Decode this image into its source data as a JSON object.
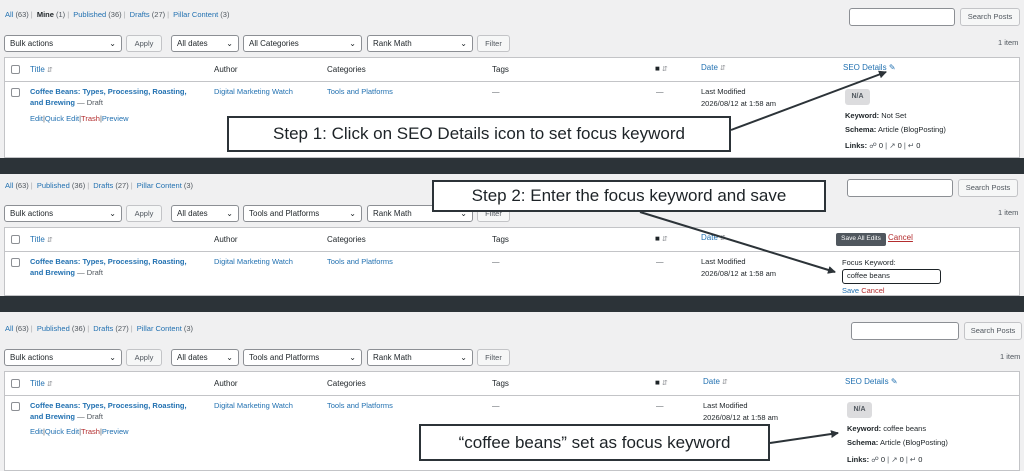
{
  "views": {
    "all": "All",
    "all_count": "(63)",
    "mine": "Mine",
    "mine_count": "(1)",
    "published": "Published",
    "published_count": "(36)",
    "drafts": "Drafts",
    "drafts_count": "(27)",
    "pillar": "Pillar Content",
    "pillar_count": "(3)",
    "sep": "|"
  },
  "toolbar": {
    "bulk_actions": "Bulk actions",
    "apply": "Apply",
    "all_dates": "All dates",
    "all_categories": "All Categories",
    "tools_platforms": "Tools and Platforms",
    "rank_math": "Rank Math",
    "filter": "Filter",
    "search_posts": "Search Posts",
    "items": "1 item"
  },
  "columns": {
    "title": "Title",
    "author": "Author",
    "categories": "Categories",
    "tags": "Tags",
    "date": "Date",
    "seo_details": "SEO Details"
  },
  "post": {
    "title_line1": "Coffee Beans: Types, Processing, Roasting,",
    "title_line2": "and Brewing",
    "state": "— Draft",
    "action_edit": "Edit",
    "action_quick_edit": "Quick Edit",
    "action_trash": "Trash",
    "action_preview": "Preview",
    "author": "Digital Marketing Watch",
    "category": "Tools and Platforms",
    "tags": "—",
    "comments": "—",
    "date_status": "Last Modified",
    "date_value": "2026/08/12 at 1:58 am"
  },
  "seo": {
    "na": "N/A",
    "keyword_label": "Keyword:",
    "keyword_not_set": "Not Set",
    "keyword_set": "coffee beans",
    "schema_label": "Schema:",
    "schema_value": "Article (BlogPosting)",
    "links_label": "Links:",
    "links_internal": "0",
    "links_external": "0",
    "links_incoming": "0",
    "save_all_edits": "Save All Edits",
    "cancel": "Cancel",
    "focus_keyword_label": "Focus Keyword:",
    "focus_keyword_value": "coffee beans",
    "save": "Save"
  },
  "callouts": {
    "step1": "Step 1: Click on SEO Details icon to set focus keyword",
    "step2": "Step 2: Enter the focus keyword and save",
    "step3": "“coffee beans” set as focus keyword"
  },
  "colors": {
    "link": "#2271b1",
    "trash": "#b32d2e",
    "divider": "#2c3338"
  },
  "icons": [
    "sort-icon",
    "comment-icon",
    "pencil-icon",
    "link-icon",
    "external-link-icon",
    "incoming-link-icon",
    "checkbox-icon",
    "chevron-down-icon"
  ]
}
